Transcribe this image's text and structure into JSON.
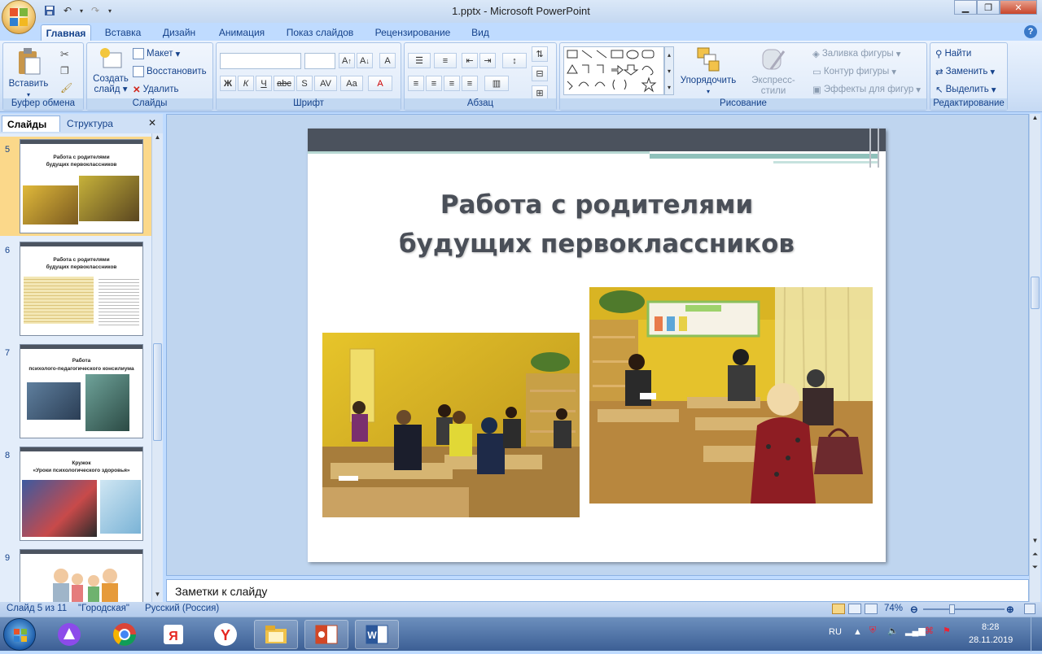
{
  "window": {
    "title": "1.pptx - Microsoft PowerPoint"
  },
  "tabs": [
    "Главная",
    "Вставка",
    "Дизайн",
    "Анимация",
    "Показ слайдов",
    "Рецензирование",
    "Вид"
  ],
  "ribbon": {
    "clipboard": {
      "paste": "Вставить",
      "label": "Буфер обмена"
    },
    "slides": {
      "create": "Создать",
      "create2": "слайд",
      "layout": "Макет",
      "reset": "Восстановить",
      "delete": "Удалить",
      "label": "Слайды"
    },
    "font": {
      "label": "Шрифт"
    },
    "paragraph": {
      "label": "Абзац"
    },
    "drawing": {
      "arrange": "Упорядочить",
      "quickstyles": "Экспресс-стили",
      "fill": "Заливка фигуры",
      "outline": "Контур фигуры",
      "effects": "Эффекты для фигур",
      "label": "Рисование"
    },
    "editing": {
      "find": "Найти",
      "replace": "Заменить",
      "select": "Выделить",
      "label": "Редактирование"
    }
  },
  "panel": {
    "tab_slides": "Слайды",
    "tab_outline": "Структура",
    "thumbs": [
      {
        "num": "5",
        "title1": "Работа с родителями",
        "title2": "будущих первоклассников"
      },
      {
        "num": "6",
        "title1": "Работа с родителями",
        "title2": "будущих первоклассников"
      },
      {
        "num": "7",
        "title1": "Работа",
        "title2": "психолого-педагогического консилиума"
      },
      {
        "num": "8",
        "title1": "Кружок",
        "title2": "«Уроки психологического здоровья»"
      },
      {
        "num": "9",
        "title1": "",
        "title2": ""
      }
    ]
  },
  "slide": {
    "title_line1": "Работа с родителями",
    "title_line2": "будущих первоклассников"
  },
  "notes": {
    "placeholder": "Заметки к слайду"
  },
  "status": {
    "slide": "Слайд 5 из 11",
    "theme": "\"Городская\"",
    "lang": "Русский (Россия)",
    "zoom": "74%"
  },
  "tray": {
    "lang": "RU",
    "time": "8:28",
    "date": "28.11.2019"
  }
}
